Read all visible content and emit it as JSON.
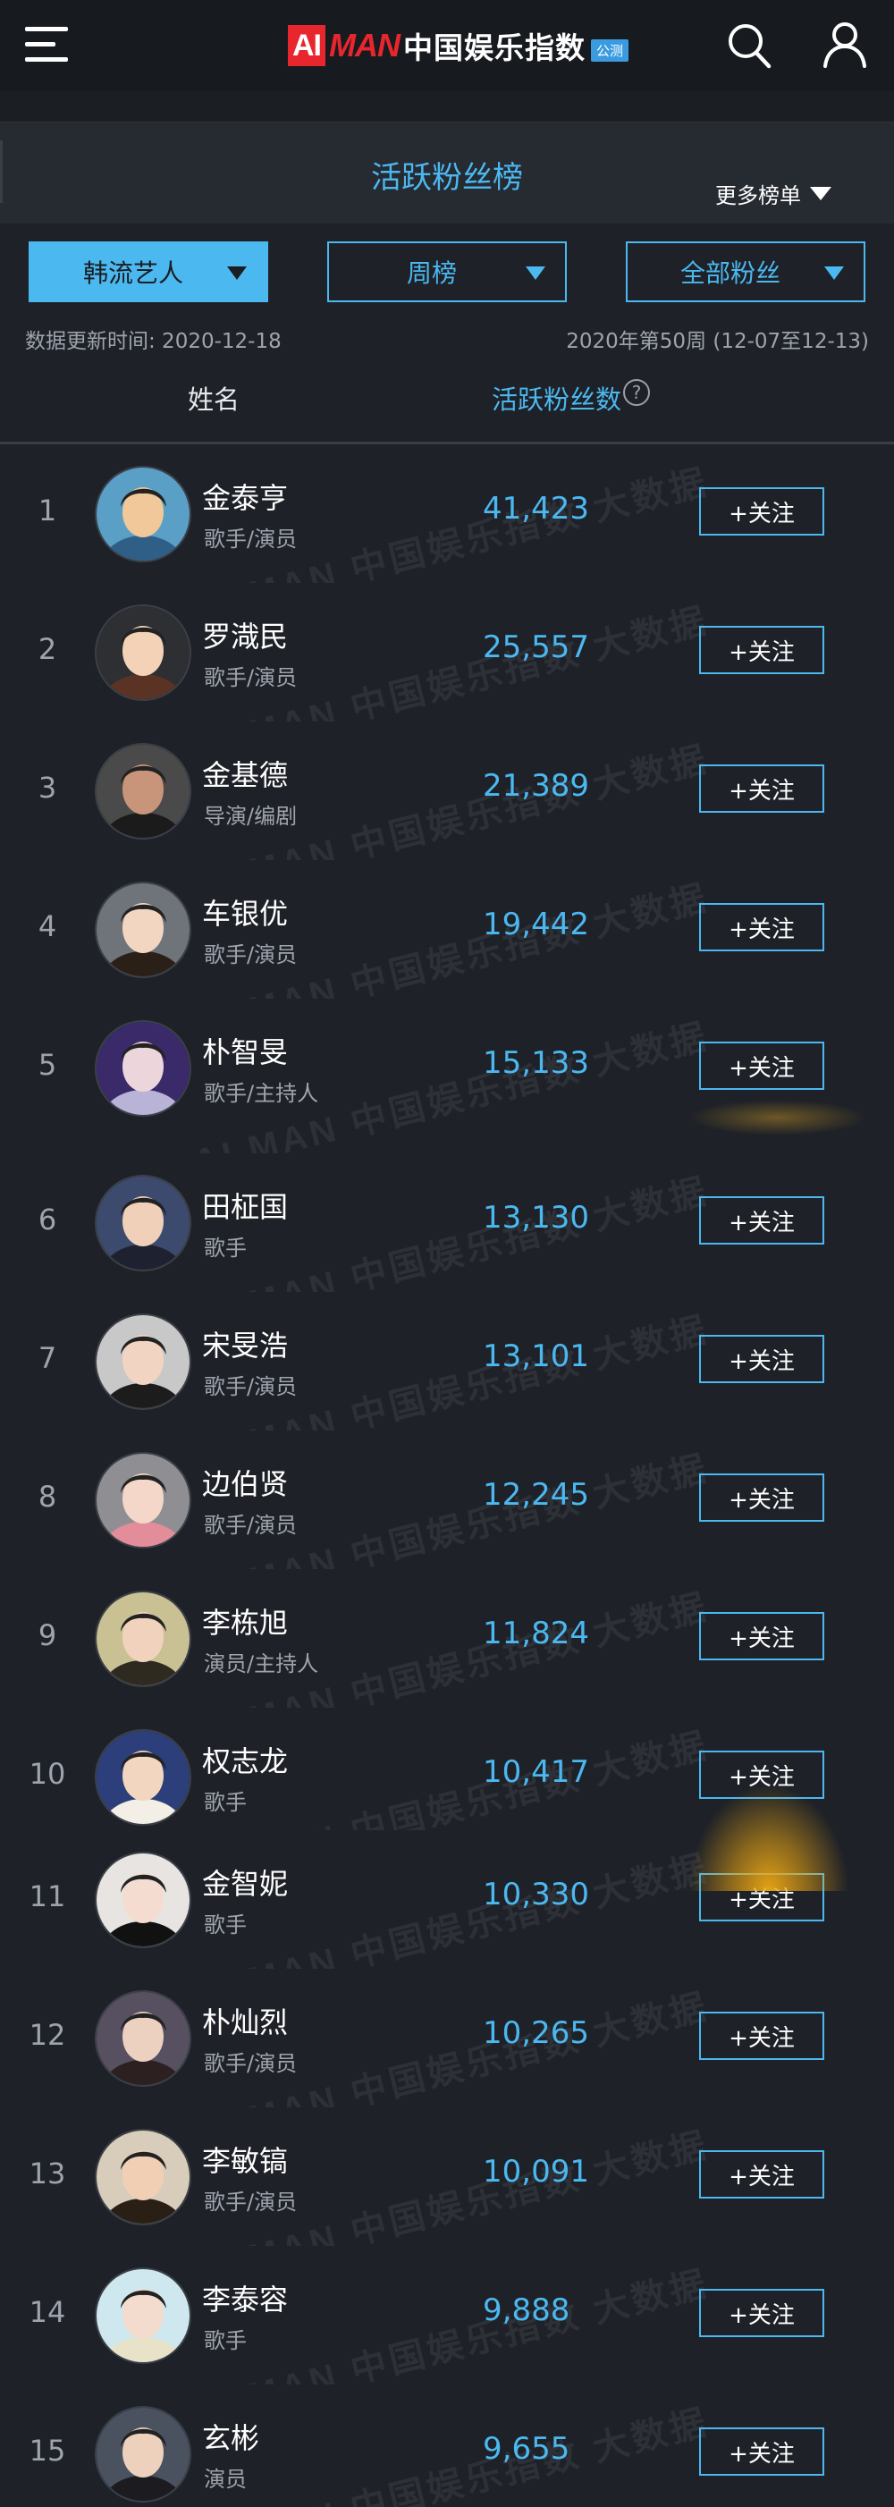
{
  "header": {
    "logo_ai": "AI",
    "logo_man": "MAN",
    "logo_cn": "中国娱乐指数",
    "logo_badge": "公测",
    "icons": [
      "menu-icon",
      "search-icon",
      "user-icon"
    ]
  },
  "panel": {
    "title": "活跃粉丝榜",
    "more_lists": "更多榜单"
  },
  "filters": [
    {
      "label": "韩流艺人",
      "active": true
    },
    {
      "label": "周榜",
      "active": false
    },
    {
      "label": "全部粉丝",
      "active": false
    }
  ],
  "meta": {
    "updated": "数据更新时间: 2020-12-18",
    "period": "2020年第50周 (12-07至12-13)"
  },
  "columns": {
    "name": "姓名",
    "fans": "活跃粉丝数",
    "help": "?"
  },
  "watermark": "AI MAN 中国娱乐指数 大数据",
  "follow_label": "+关注",
  "colors": {
    "accent": "#4bb8f0",
    "background": "#1e2127",
    "header": "#171a1f",
    "brand_red": "#e8262d"
  },
  "rows": [
    {
      "rank": "1",
      "name": "金泰亨",
      "role": "歌手/演员",
      "fans": "41,423"
    },
    {
      "rank": "2",
      "name": "罗渽民",
      "role": "歌手/演员",
      "fans": "25,557"
    },
    {
      "rank": "3",
      "name": "金基德",
      "role": "导演/编剧",
      "fans": "21,389"
    },
    {
      "rank": "4",
      "name": "车银优",
      "role": "歌手/演员",
      "fans": "19,442"
    },
    {
      "rank": "5",
      "name": "朴智旻",
      "role": "歌手/主持人",
      "fans": "15,133"
    },
    {
      "rank": "6",
      "name": "田柾国",
      "role": "歌手",
      "fans": "13,130"
    },
    {
      "rank": "7",
      "name": "宋旻浩",
      "role": "歌手/演员",
      "fans": "13,101"
    },
    {
      "rank": "8",
      "name": "边伯贤",
      "role": "歌手/演员",
      "fans": "12,245"
    },
    {
      "rank": "9",
      "name": "李栋旭",
      "role": "演员/主持人",
      "fans": "11,824"
    },
    {
      "rank": "10",
      "name": "权志龙",
      "role": "歌手",
      "fans": "10,417"
    },
    {
      "rank": "11",
      "name": "金智妮",
      "role": "歌手",
      "fans": "10,330"
    },
    {
      "rank": "12",
      "name": "朴灿烈",
      "role": "歌手/演员",
      "fans": "10,265"
    },
    {
      "rank": "13",
      "name": "李敏镐",
      "role": "歌手/演员",
      "fans": "10,091"
    },
    {
      "rank": "14",
      "name": "李泰容",
      "role": "歌手",
      "fans": "9,888"
    },
    {
      "rank": "15",
      "name": "玄彬",
      "role": "演员",
      "fans": "9,655"
    }
  ]
}
